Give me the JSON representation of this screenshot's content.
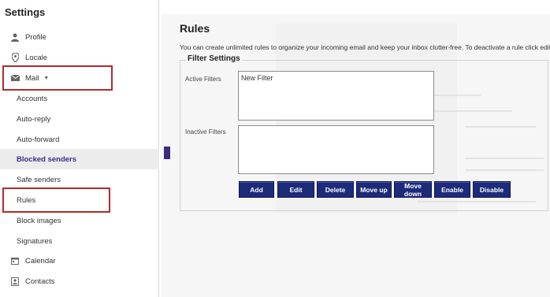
{
  "sidebar": {
    "title": "Settings",
    "items": [
      {
        "label": "Profile",
        "icon": "person-icon"
      },
      {
        "label": "Locale",
        "icon": "location-pin-icon"
      },
      {
        "label": "Mail",
        "icon": "mail-icon",
        "expanded": true
      },
      {
        "label": "Accounts"
      },
      {
        "label": "Auto-reply"
      },
      {
        "label": "Auto-forward"
      },
      {
        "label": "Blocked senders",
        "selected": true
      },
      {
        "label": "Safe senders"
      },
      {
        "label": "Rules"
      },
      {
        "label": "Block images"
      },
      {
        "label": "Signatures"
      },
      {
        "label": "Calendar",
        "icon": "calendar-icon"
      },
      {
        "label": "Contacts",
        "icon": "contacts-icon"
      }
    ]
  },
  "main": {
    "title": "Rules",
    "description": "You can create unlimited rules to organize your incoming email and keep your inbox clutter-free. To deactivate a rule click edit and",
    "filter_settings": {
      "legend": "Filter Settings",
      "active_label": "Active Filters",
      "active_items": [
        "New Filter"
      ],
      "inactive_label": "Inactive Filters",
      "inactive_items": []
    },
    "buttons": [
      "Add",
      "Edit",
      "Delete",
      "Move up",
      "Move down",
      "Enable",
      "Disable"
    ]
  },
  "colors": {
    "button_bg": "#1d2b7a",
    "highlight_border": "#b22b2b",
    "selected_text": "#3b2a8a"
  }
}
